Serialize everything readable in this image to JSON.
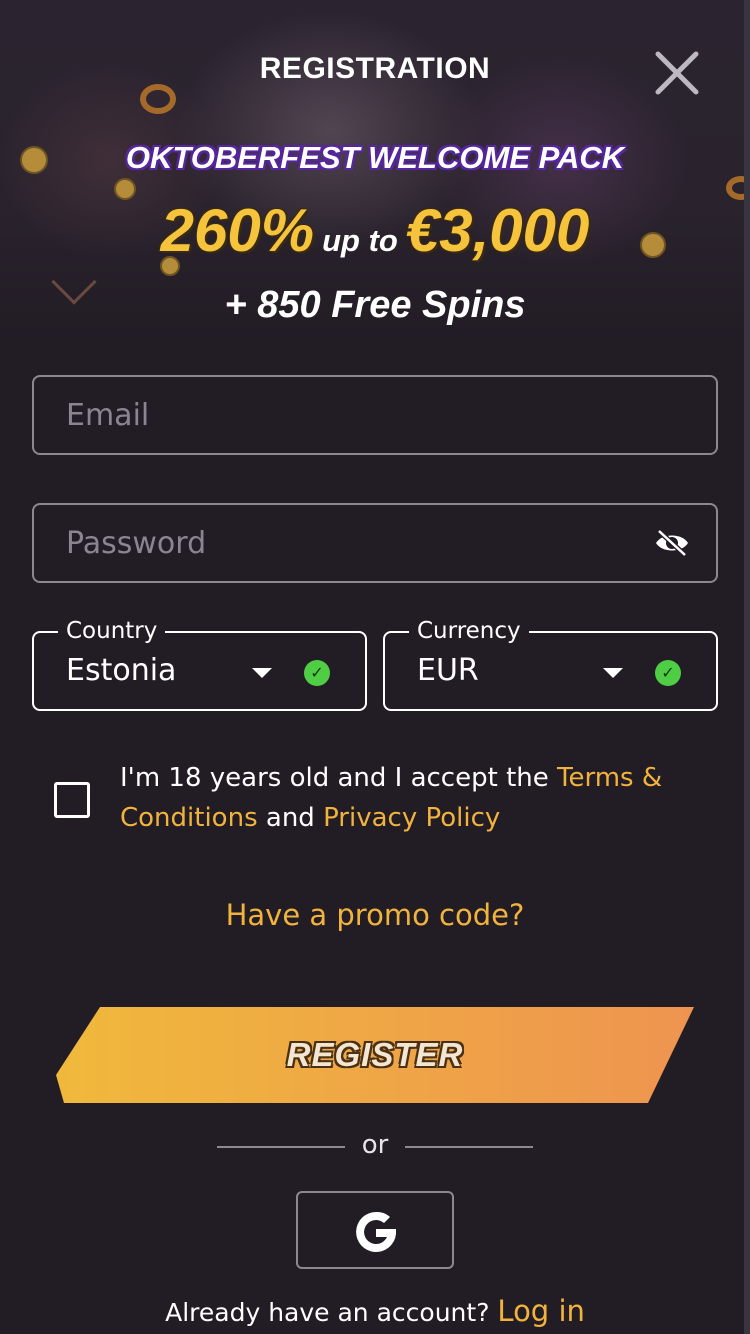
{
  "header": {
    "title": "REGISTRATION"
  },
  "promo": {
    "subtitle": "OKTOBERFEST WELCOME PACK",
    "percent": "260%",
    "up_to": "up to",
    "amount": "€3,000",
    "spins": "+ 850 Free Spins"
  },
  "form": {
    "email_placeholder": "Email",
    "password_placeholder": "Password",
    "country_label": "Country",
    "country_value": "Estonia",
    "currency_label": "Currency",
    "currency_value": "EUR",
    "consent_prefix": "I'm 18 years old and I accept the ",
    "terms_link": "Terms & Conditions",
    "consent_and": " and ",
    "privacy_link": "Privacy Policy",
    "promo_code_link": "Have a promo code?",
    "register_label": "REGISTER",
    "or_label": "or"
  },
  "footer": {
    "prompt": "Already have an account?",
    "login_link": "Log in"
  },
  "colors": {
    "background": "#221c25",
    "accent": "#f2b33d",
    "register_gradient_start": "#f0b93b",
    "register_gradient_end": "#ee9450",
    "success": "#4fce45",
    "promo_gold": "#f6c43c",
    "promo_outline": "#5b2aa6"
  },
  "icons": {
    "close": "close-icon",
    "password_toggle": "eye-slash-icon",
    "dropdown": "caret-down-icon",
    "valid": "check-circle-icon",
    "google": "google-icon"
  }
}
